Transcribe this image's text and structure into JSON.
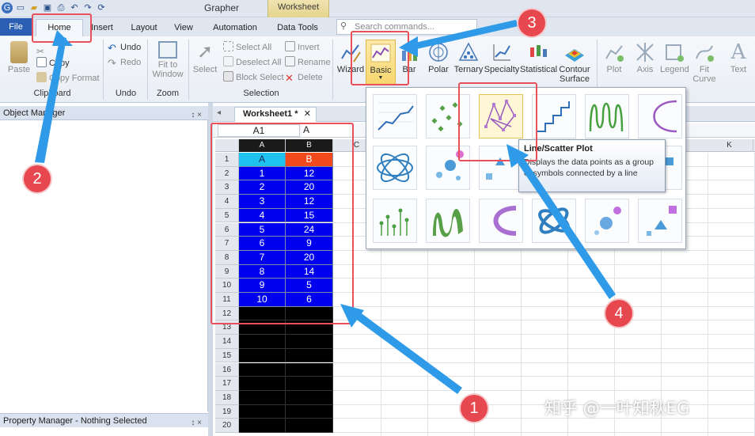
{
  "app": {
    "title": "Grapher",
    "context_tab": "Worksheet"
  },
  "ribbon_tabs": [
    "File",
    "Home",
    "Insert",
    "Layout",
    "View",
    "Automation",
    "Data Tools"
  ],
  "search": {
    "placeholder": "Search commands..."
  },
  "ribbon": {
    "clipboard": {
      "label": "Clipboard",
      "paste": "Paste",
      "copy": "Copy",
      "copy_format": "Copy Format"
    },
    "undo": {
      "label": "Undo",
      "undo": "Undo",
      "redo": "Redo"
    },
    "zoom": {
      "label": "Zoom",
      "fit_to_window": "Fit to Window"
    },
    "selection": {
      "label": "Selection",
      "select": "Select",
      "select_all": "Select All",
      "deselect_all": "Deselect All",
      "block_select": "Block Select",
      "invert": "Invert",
      "rename": "Rename",
      "delete": "Delete"
    },
    "graphs": [
      "Wizard",
      "Basic",
      "Bar",
      "Polar",
      "Ternary",
      "Specialty",
      "Statistical",
      "Contour Surface"
    ],
    "add": [
      "Plot",
      "Axis",
      "Legend",
      "Fit Curve",
      "Text"
    ]
  },
  "panels": {
    "object_manager": "Object Manager",
    "property_manager": "Property Manager - Nothing Selected",
    "pin": "↕ ×"
  },
  "worksheet": {
    "tab": "Worksheet1 *",
    "cell_ref": "A1",
    "cell_value": "A",
    "col_headers": [
      "A",
      "B",
      "C",
      "K"
    ],
    "row_numbers": [
      "1",
      "2",
      "3",
      "4",
      "5",
      "6",
      "7",
      "8",
      "9",
      "10",
      "11",
      "12",
      "13",
      "14",
      "15",
      "16",
      "17",
      "18",
      "19",
      "20"
    ],
    "header_row": [
      "A",
      "B"
    ],
    "rows": [
      [
        "1",
        "12"
      ],
      [
        "2",
        "20"
      ],
      [
        "3",
        "12"
      ],
      [
        "4",
        "15"
      ],
      [
        "5",
        "24"
      ],
      [
        "6",
        "9"
      ],
      [
        "7",
        "20"
      ],
      [
        "8",
        "14"
      ],
      [
        "9",
        "5"
      ],
      [
        "10",
        "6"
      ]
    ]
  },
  "tooltip": {
    "title": "Line/Scatter Plot",
    "text": "Displays the data points as a group of symbols connected by a line"
  },
  "annotations": [
    "1",
    "2",
    "3",
    "4"
  ],
  "watermark": "知乎 @一叶知秋EG",
  "colors": {
    "file_tab": "#2b5fb4",
    "annotation": "#e7474f",
    "arrow": "#2f9be8",
    "header_a": "#1fc2ee",
    "header_b": "#f24a1c",
    "data_cells": "#0000ee"
  }
}
